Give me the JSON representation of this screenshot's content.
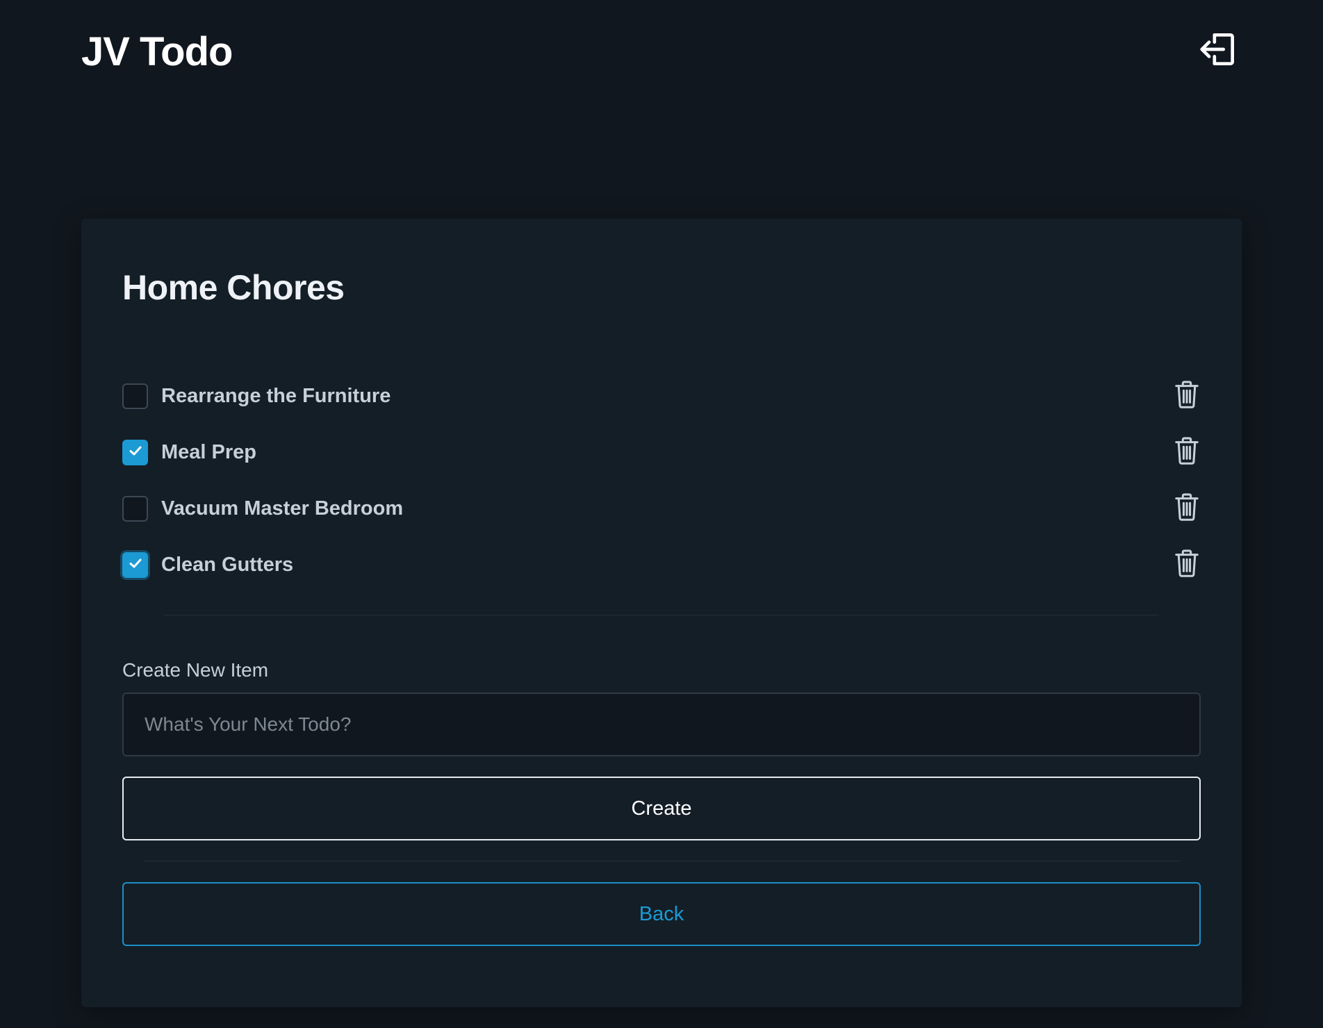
{
  "header": {
    "brand": "JV Todo",
    "logout_icon": "logout-icon"
  },
  "card": {
    "title": "Home Chores",
    "items": [
      {
        "label": "Rearrange the Furniture",
        "checked": false
      },
      {
        "label": "Meal Prep",
        "checked": true
      },
      {
        "label": "Vacuum Master Bedroom",
        "checked": false
      },
      {
        "label": "Clean Gutters",
        "checked": true,
        "focused": true
      }
    ],
    "delete_icon": "trash-icon"
  },
  "form": {
    "label": "Create New Item",
    "input_value": "",
    "input_placeholder": "What's Your Next Todo?",
    "create_label": "Create",
    "back_label": "Back"
  },
  "colors": {
    "background": "#11171e",
    "card": "#141e27",
    "accent": "#1b9ad4"
  }
}
